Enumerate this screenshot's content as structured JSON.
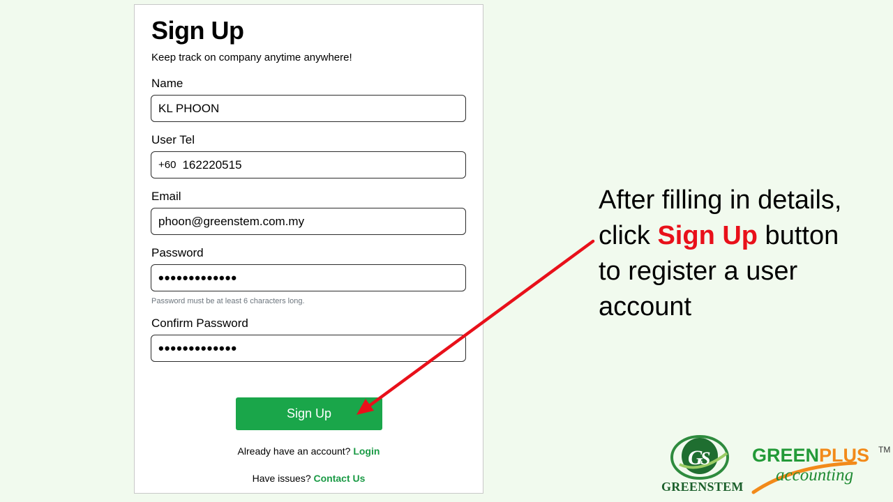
{
  "form": {
    "title": "Sign Up",
    "subtitle": "Keep track on company anytime anywhere!",
    "name_label": "Name",
    "name_value": "KL PHOON",
    "tel_label": "User Tel",
    "tel_prefix": "+60",
    "tel_value": "162220515",
    "email_label": "Email",
    "email_value": "phoon@greenstem.com.my",
    "password_label": "Password",
    "password_value": "•••••••••••••",
    "password_hint": "Password must be at least 6 characters long.",
    "confirm_label": "Confirm Password",
    "confirm_value": "•••••••••••••",
    "signup_button": "Sign Up",
    "login_prompt": "Already have an account?",
    "login_link": "Login",
    "issues_prompt": "Have issues?",
    "contact_link": "Contact Us"
  },
  "callout": {
    "line1": "After filling in details,",
    "line2_pre": "click ",
    "line2_emph": "Sign Up",
    "line2_post": " button",
    "line3": "to register a user",
    "line4": "account"
  },
  "logos": {
    "greenstem": "GREENSTEM",
    "greenplus_green": "GREEN",
    "greenplus_orange": "PLUS",
    "greenplus_tm": "TM",
    "greenplus_sub": "accounting"
  },
  "colors": {
    "background": "#f1faee",
    "button": "#1aa64a",
    "link": "#1a9a45",
    "accent_red": "#e8101a",
    "greenplus_orange": "#f28a1a"
  }
}
